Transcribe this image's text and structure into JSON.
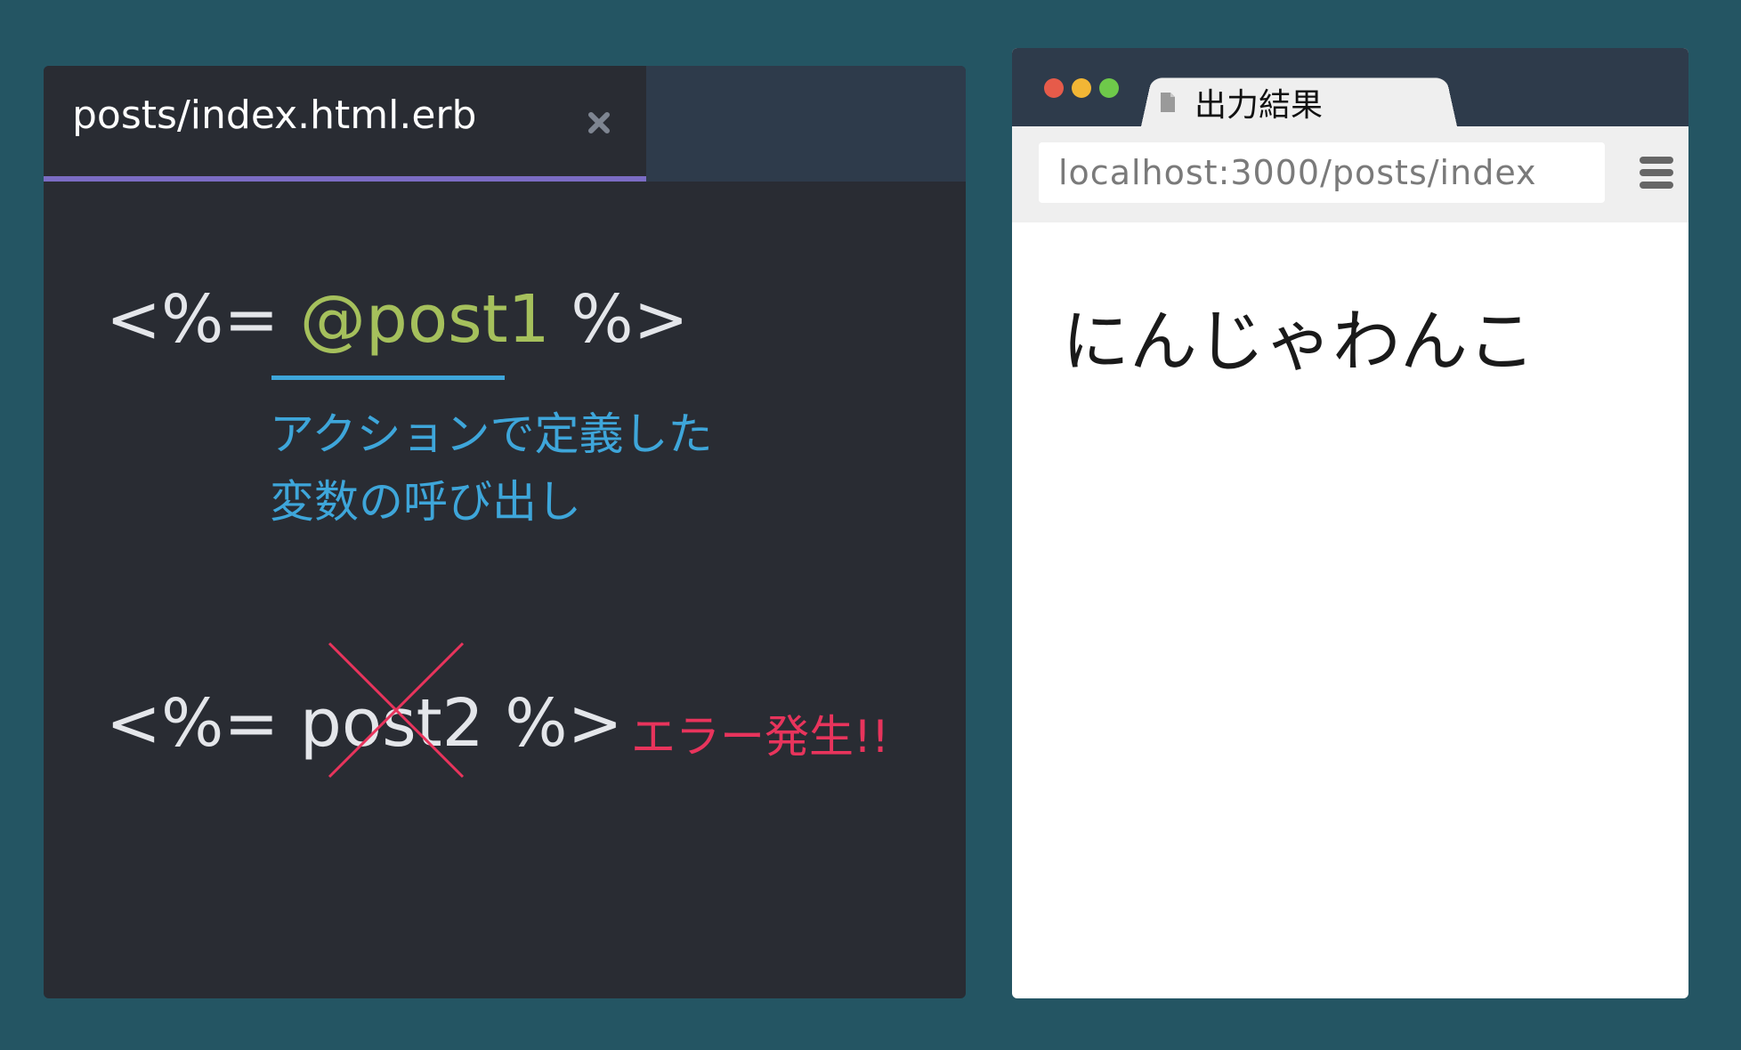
{
  "editor": {
    "tab": {
      "filename": "posts/index.html.erb",
      "close_glyph": "×"
    },
    "code_line_1": {
      "open": "<%= ",
      "variable": "@post1",
      "close": " %>"
    },
    "annotation": {
      "line1": "アクションで定義した",
      "line2": "変数の呼び出し"
    },
    "code_line_2": {
      "open": "<%= ",
      "variable": "post2",
      "close": " %>"
    },
    "error_label": "エラー発生!!"
  },
  "browser": {
    "tab_title": "出力結果",
    "url": "localhost:3000/posts/index",
    "page_text": "にんじゃわんこ"
  },
  "icons": {
    "tab_close": "close-icon",
    "cross": "cross-icon",
    "document": "document-icon",
    "menu": "menu-icon"
  },
  "colors": {
    "background": "#245563",
    "editor_bg": "#292c33",
    "tab_accent": "#7b6cc4",
    "variable_ok": "#a5c05c",
    "annotation": "#3ea6da",
    "error": "#e8345c"
  }
}
